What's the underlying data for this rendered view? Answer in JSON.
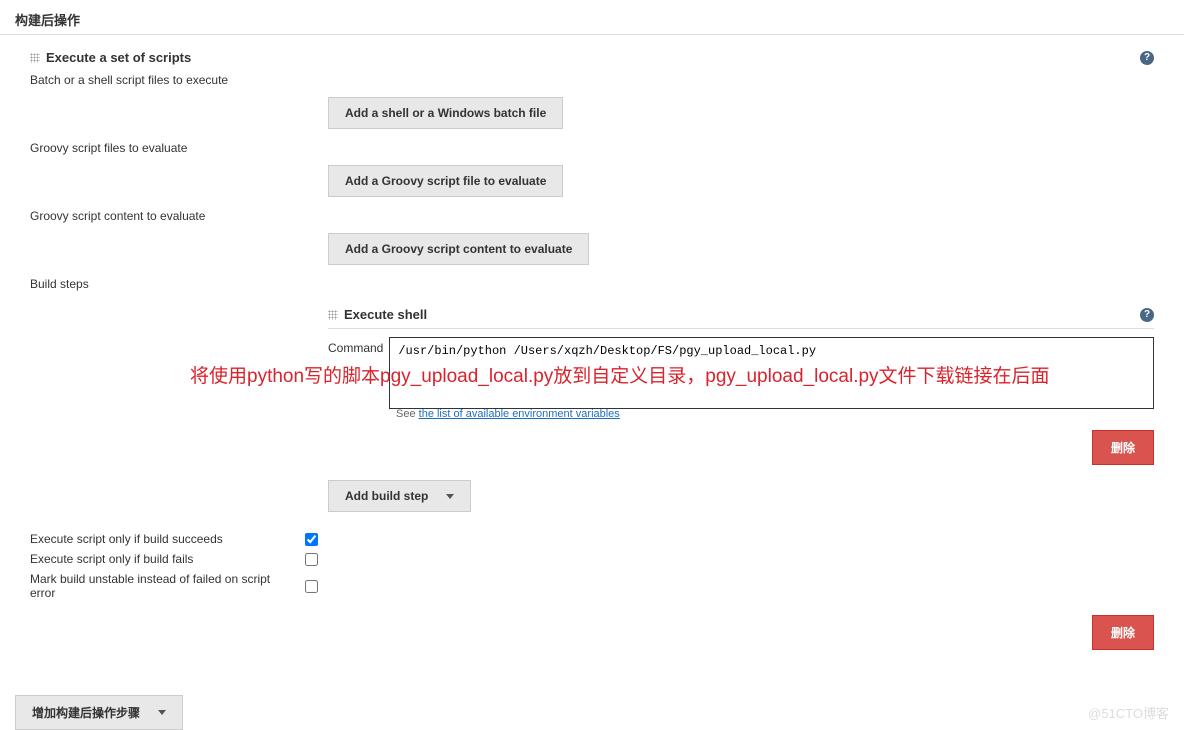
{
  "page_title": "构建后操作",
  "section": {
    "title": "Execute a set of scripts",
    "batch_label": "Batch or a shell script files to execute",
    "batch_button": "Add a shell or a Windows batch file",
    "groovy_files_label": "Groovy script files to evaluate",
    "groovy_files_button": "Add a Groovy script file to evaluate",
    "groovy_content_label": "Groovy script content to evaluate",
    "groovy_content_button": "Add a Groovy script content to evaluate",
    "build_steps_label": "Build steps"
  },
  "execute_shell": {
    "title": "Execute shell",
    "command_label": "Command",
    "command_value": "/usr/bin/python /Users/xqzh/Desktop/FS/pgy_upload_local.py",
    "see_prefix": "See ",
    "see_link": "the list of available environment variables"
  },
  "annotation": "将使用python写的脚本pgy_upload_local.py放到自定义目录，pgy_upload_local.py文件下载链接在后面",
  "buttons": {
    "add_build_step": "Add build step",
    "delete": "删除",
    "add_post_build": "增加构建后操作步骤"
  },
  "checkboxes": {
    "succeed": "Execute script only if build succeeds",
    "fails": "Execute script only if build fails",
    "unstable": "Mark build unstable instead of failed on script error"
  },
  "watermark": "@51CTO博客"
}
